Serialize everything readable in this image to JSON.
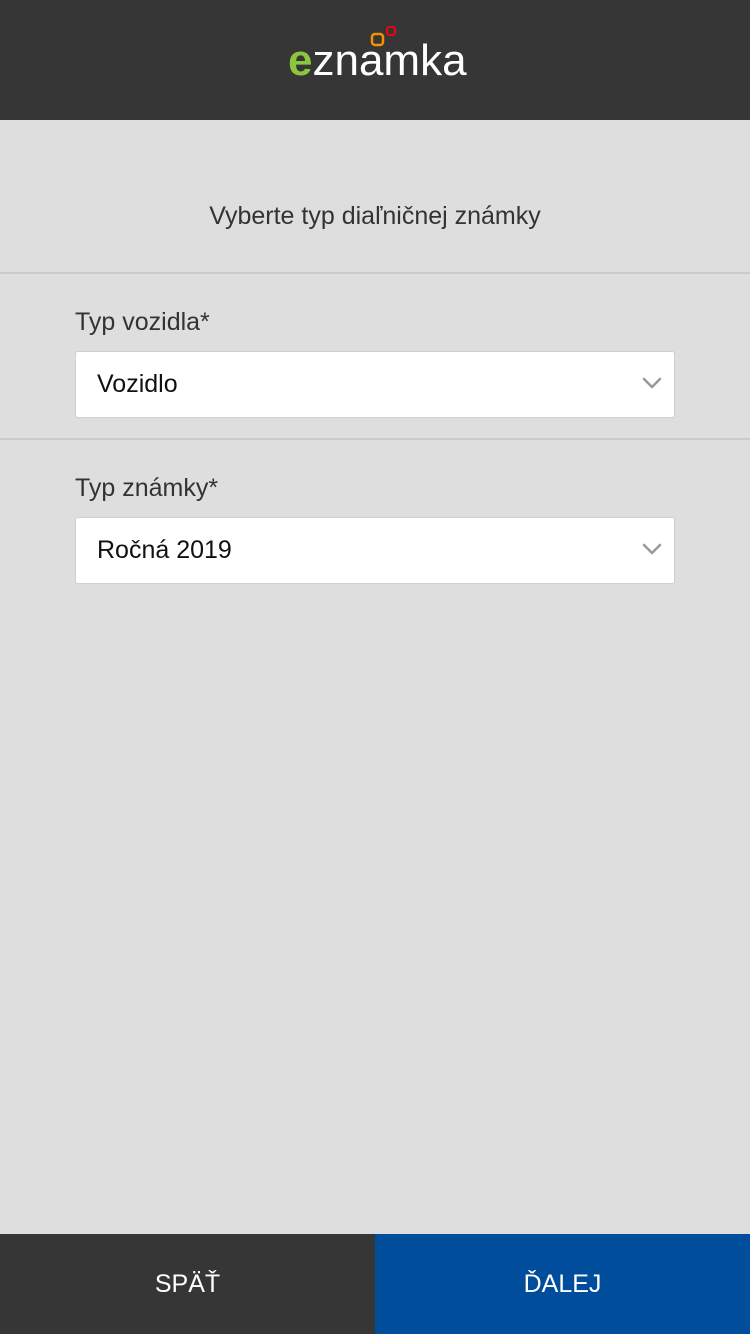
{
  "header": {
    "logo_text_first": "e",
    "logo_text_rest": "znamka",
    "logo_alt": "eznamka",
    "colors": {
      "background": "#363636",
      "logo_e": "#8cc63f",
      "logo_dot_1": "#f39200",
      "logo_dot_2": "#e30613"
    }
  },
  "main": {
    "title": "Vyberte typ diaľničnej známky",
    "fields": [
      {
        "label": "Typ vozidla*",
        "value": "Vozidlo",
        "icon": "chevron-down-icon"
      },
      {
        "label": "Typ známky*",
        "value": "Ročná 2019",
        "icon": "chevron-down-icon"
      }
    ]
  },
  "footer": {
    "back_label": "SPÄŤ",
    "next_label": "ĎALEJ",
    "colors": {
      "back": "#363636",
      "next": "#004d9c"
    }
  }
}
